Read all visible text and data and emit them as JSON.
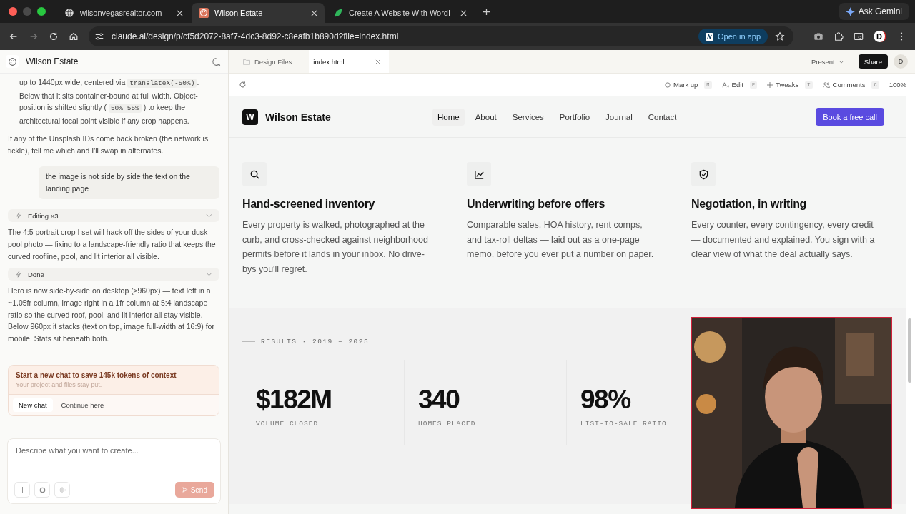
{
  "browser": {
    "tabs": [
      {
        "title": "wilsonvegasrealtor.com",
        "selected": false
      },
      {
        "title": "Wilson Estate",
        "selected": true
      },
      {
        "title": "Create A Website With WordI",
        "selected": false
      }
    ],
    "ask_gemini": "Ask Gemini",
    "url": "claude.ai/design/p/cf5d2072-8af7-4dc3-8d92-c8eafb1b890d?file=index.html",
    "open_in_app": "Open in app",
    "profile": "D"
  },
  "chat": {
    "project_title": "Wilson Estate",
    "items": [
      {
        "kind": "para",
        "indented": true,
        "segments": [
          {
            "kind": "text",
            "text": "up to 1440px wide, centered via "
          },
          {
            "kind": "code",
            "text": "translateX(-50%)"
          },
          {
            "kind": "text",
            "text": ". Below that it sits container-bound at full width. Object-position is shifted slightly ( "
          },
          {
            "kind": "code",
            "text": "50% 55%"
          },
          {
            "kind": "text",
            "text": " ) to keep the architectural focal point visible if any crop happens."
          }
        ]
      },
      {
        "kind": "para",
        "indented": false,
        "segments": [
          {
            "kind": "text",
            "text": "If any of the Unsplash IDs come back broken (the network is fickle), tell me which and I'll swap in alternates."
          }
        ]
      },
      {
        "kind": "user",
        "text": "the image is not side by side the text on the landing page"
      },
      {
        "kind": "tool",
        "label": "Editing ×3"
      },
      {
        "kind": "para",
        "indented": false,
        "segments": [
          {
            "kind": "text",
            "text": "The 4:5 portrait crop I set will hack off the sides of your dusk pool photo — fixing to a landscape-friendly ratio that keeps the curved roofline, pool, and lit interior all visible."
          }
        ]
      },
      {
        "kind": "tool",
        "label": "Done"
      },
      {
        "kind": "para",
        "indented": false,
        "segments": [
          {
            "kind": "text",
            "text": "Hero is now side-by-side on desktop (≥960px) — text left in a ~1.05fr column, image right in a 1fr column at 5:4 landscape ratio so the curved roof, pool, and lit interior all stay visible. Below 960px it stacks (text on top, image full-width at 16:9) for mobile. Stats sit beneath both."
          }
        ]
      }
    ],
    "notice": {
      "title": "Start a new chat to save 145k tokens of context",
      "subtitle": "Your project and files stay put.",
      "buttons": [
        {
          "label": "New chat",
          "selected": true
        },
        {
          "label": "Continue here",
          "selected": false
        }
      ]
    },
    "composer": {
      "placeholder": "Describe what you want to create...",
      "send": "Send"
    }
  },
  "preview": {
    "file_tabs": [
      {
        "label": "Design Files",
        "selected": false
      },
      {
        "label": "index.html",
        "selected": true
      }
    ],
    "present": "Present",
    "share": "Share",
    "avatar": "D",
    "tools": [
      {
        "label": "Mark up",
        "key": "M"
      },
      {
        "label": "Edit",
        "key": "E"
      },
      {
        "label": "Tweaks",
        "key": "T"
      },
      {
        "label": "Comments",
        "key": "C"
      }
    ],
    "zoom": "100%",
    "site": {
      "logo": "W",
      "brand": "Wilson Estate",
      "nav": [
        {
          "label": "Home",
          "selected": true
        },
        {
          "label": "About",
          "selected": false
        },
        {
          "label": "Services",
          "selected": false
        },
        {
          "label": "Portfolio",
          "selected": false
        },
        {
          "label": "Journal",
          "selected": false
        },
        {
          "label": "Contact",
          "selected": false
        }
      ],
      "cta": "Book a free call",
      "features": [
        {
          "title": "Hand-screened inventory",
          "body": "Every property is walked, photographed at the curb, and cross-checked against neighborhood permits before it lands in your inbox. No drive-bys you'll regret."
        },
        {
          "title": "Underwriting before offers",
          "body": "Comparable sales, HOA history, rent comps, and tax-roll deltas — laid out as a one-page memo, before you ever put a number on paper."
        },
        {
          "title": "Negotiation, in writing",
          "body": "Every counter, every contingency, every credit — documented and explained. You sign with a clear view of what the deal actually says."
        }
      ],
      "results_label": "RESULTS · 2019 – 2025",
      "stats": [
        {
          "value": "$182M",
          "label": "VOLUME CLOSED"
        },
        {
          "value": "340",
          "label": "HOMES PLACED"
        },
        {
          "value": "98%",
          "label": "LIST-TO-SALE RATIO"
        }
      ]
    }
  }
}
